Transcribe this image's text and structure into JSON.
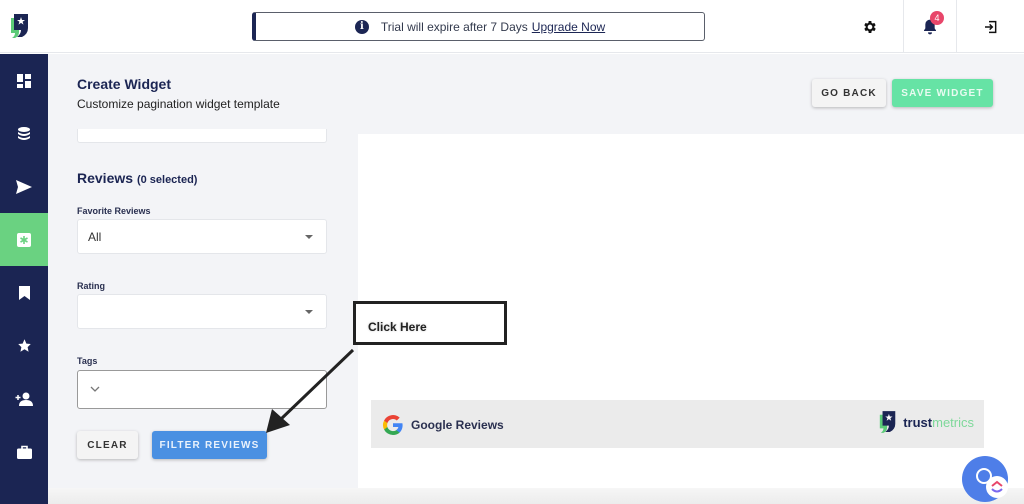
{
  "topbar": {
    "logo": "trustmetrics-logo",
    "trial_text": "Trial will expire after 7 Days",
    "trial_link": "Upgrade Now",
    "notification_count": "4"
  },
  "sidebar": {
    "items": [
      {
        "icon": "dashboard-icon",
        "active": false
      },
      {
        "icon": "database-icon",
        "active": false
      },
      {
        "icon": "send-icon",
        "active": false
      },
      {
        "icon": "widget-icon",
        "active": true
      },
      {
        "icon": "bookmark-icon",
        "active": false
      },
      {
        "icon": "star-icon",
        "active": false
      },
      {
        "icon": "add-user-icon",
        "active": false
      },
      {
        "icon": "briefcase-icon",
        "active": false
      }
    ]
  },
  "header": {
    "title": "Create Widget",
    "subtitle": "Customize pagination widget template",
    "go_back_label": "GO BACK",
    "save_label": "SAVE WIDGET"
  },
  "filters": {
    "section_title": "Reviews",
    "selected_count": "(0 selected)",
    "favorite_label": "Favorite Reviews",
    "favorite_value": "All",
    "rating_label": "Rating",
    "rating_value": "",
    "tags_label": "Tags",
    "clear_label": "CLEAR",
    "filter_label": "FILTER REVIEWS"
  },
  "preview": {
    "source_label": "Google Reviews",
    "brand_bold": "trust",
    "brand_light": "metrics"
  },
  "annotation": {
    "callout_text": "Click Here"
  },
  "colors": {
    "navy": "#1b2553",
    "green": "#6ad281",
    "save_green": "#66e3a5",
    "blue": "#4a90e2",
    "badge_red": "#e8466a"
  }
}
